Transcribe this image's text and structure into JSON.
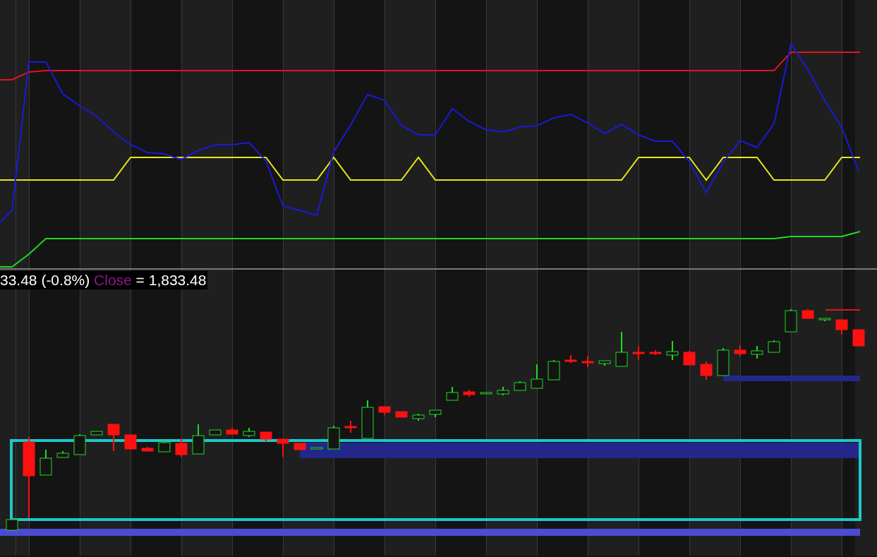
{
  "legend": {
    "change": "33.48 (-0.8%)",
    "close_label": "Close",
    "close_value": "= 1,833.48"
  }
}
